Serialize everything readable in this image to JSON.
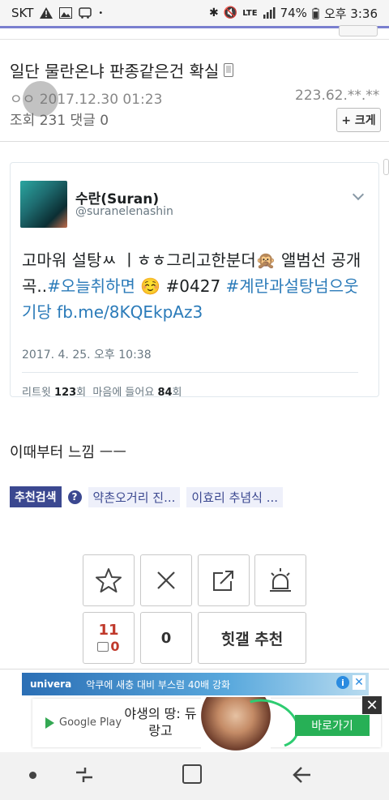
{
  "statusbar": {
    "carrier": "SKT",
    "lte": "LTE",
    "battery": "74%",
    "time": "오후 3:36"
  },
  "post": {
    "title": "일단 물란온냐 판종같은건 확실",
    "author": "ㅇㅇ",
    "datetime": "2017.12.30 01:23",
    "ip": "223.62.**.**",
    "views_label": "조회",
    "views": "231",
    "comments_label": "댓글",
    "comments": "0",
    "enlarge_label": "+ 크게"
  },
  "tweet": {
    "name": "수란(Suran)",
    "handle": "@suranelenashin",
    "text_plain": "고마워 설탕ㅆ ㅣㅎㅎ그리고한분더🙊 앨범선 공개곡..",
    "hashtag1": "#오늘취하면",
    "emoji": "☺️",
    "text_mid": " #0427 ",
    "hashtag2": "#계란과설탕넘으웃기당",
    "link": "fb.me/8KQEkpAz3",
    "date": "2017. 4. 25. 오후 10:38",
    "retweets_label": "리트윗",
    "retweets": "123",
    "retweets_unit": "회",
    "likes_label": "마음에 들어요",
    "likes": "84",
    "likes_unit": "회"
  },
  "comment_text": "이때부터 느낌 ㅡㅡ",
  "recommend": {
    "label": "추천검색",
    "help": "?",
    "links": [
      "약촌오거리 진...",
      "이효리 추념식 ..."
    ]
  },
  "vote": {
    "up_count": "11",
    "fixed_count": "0",
    "down_count": "0",
    "hit_label": "힛갤 추천"
  },
  "ads": {
    "top_brand": "univera",
    "top_text": "악쿠에 새충 대비 부스럼 40배 강화",
    "info": "i",
    "close": "✕",
    "google_play": "Google Play",
    "headline": "야생의 땅: 듀랑고",
    "install": "바로가기",
    "close_x": "✕"
  },
  "colors": {
    "accent": "#3b4890",
    "link": "#2b7bb9",
    "upvote": "#c0392b",
    "install": "#27b056"
  }
}
